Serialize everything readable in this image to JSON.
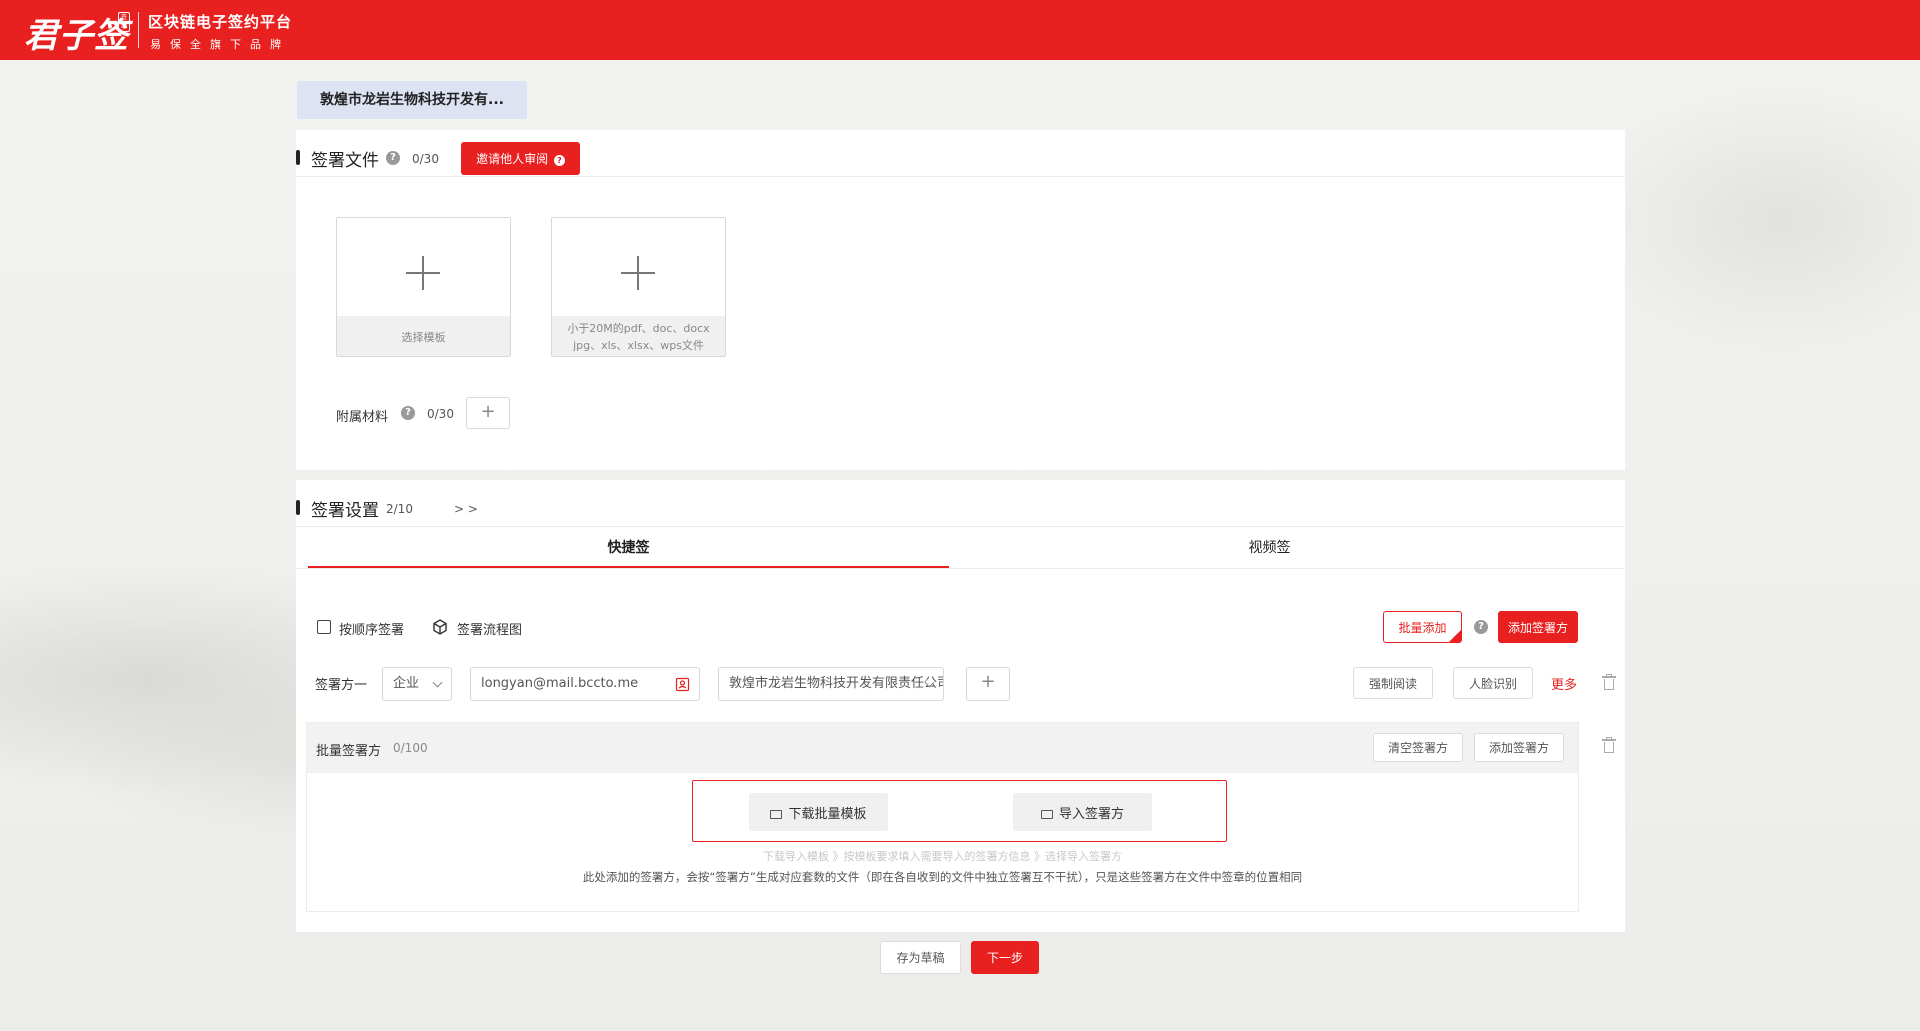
{
  "header": {
    "logo_text": "君子签",
    "logo_seal": "签约",
    "platform_title": "区块链电子签约平台",
    "platform_sub": "易保全旗下品牌"
  },
  "company_tab": "敦煌市龙岩生物科技开发有...",
  "sign_files": {
    "title": "签署文件",
    "count": "0/30",
    "invite_button": "邀请他人审阅",
    "template_caption": "选择模板",
    "upload_caption_line1": "小于20M的pdf、doc、docx",
    "upload_caption_line2": "jpg、xls、xlsx、wps文件",
    "attachments_label": "附属材料",
    "attachments_count": "0/30"
  },
  "sign_settings": {
    "title": "签署设置",
    "count": "2/10",
    "expand": "> >",
    "tabs": [
      {
        "label": "快捷签",
        "active": true
      },
      {
        "label": "视频签",
        "active": false
      }
    ],
    "sequential_label": "按顺序签署",
    "flowchart_label": "签署流程图",
    "batch_add_button": "批量添加",
    "add_signer_button": "添加签署方",
    "signer": {
      "label": "签署方一",
      "type": "企业",
      "email": "longyan@mail.bccto.me",
      "company": "敦煌市龙岩生物科技开发有限责任公司",
      "force_read": "强制阅读",
      "face_recog": "人脸识别",
      "more": "更多"
    },
    "batch": {
      "title": "批量签署方",
      "count": "0/100",
      "clear_button": "清空签署方",
      "add_button": "添加签署方",
      "download_template": "下载批量模板",
      "import_signers": "导入签署方",
      "steps": "下载导入模板 》按模板要求填入需要导入的签署方信息 》选择导入签署方",
      "note": "此处添加的签署方，会按“签署方”生成对应套数的文件（即在各自收到的文件中独立签署互不干扰），只是这些签署方在文件中签章的位置相同"
    }
  },
  "footer": {
    "save_draft": "存为草稿",
    "next_step": "下一步"
  },
  "colors": {
    "brand_red": "#e8201f",
    "tab_bg": "#dde3f3"
  }
}
